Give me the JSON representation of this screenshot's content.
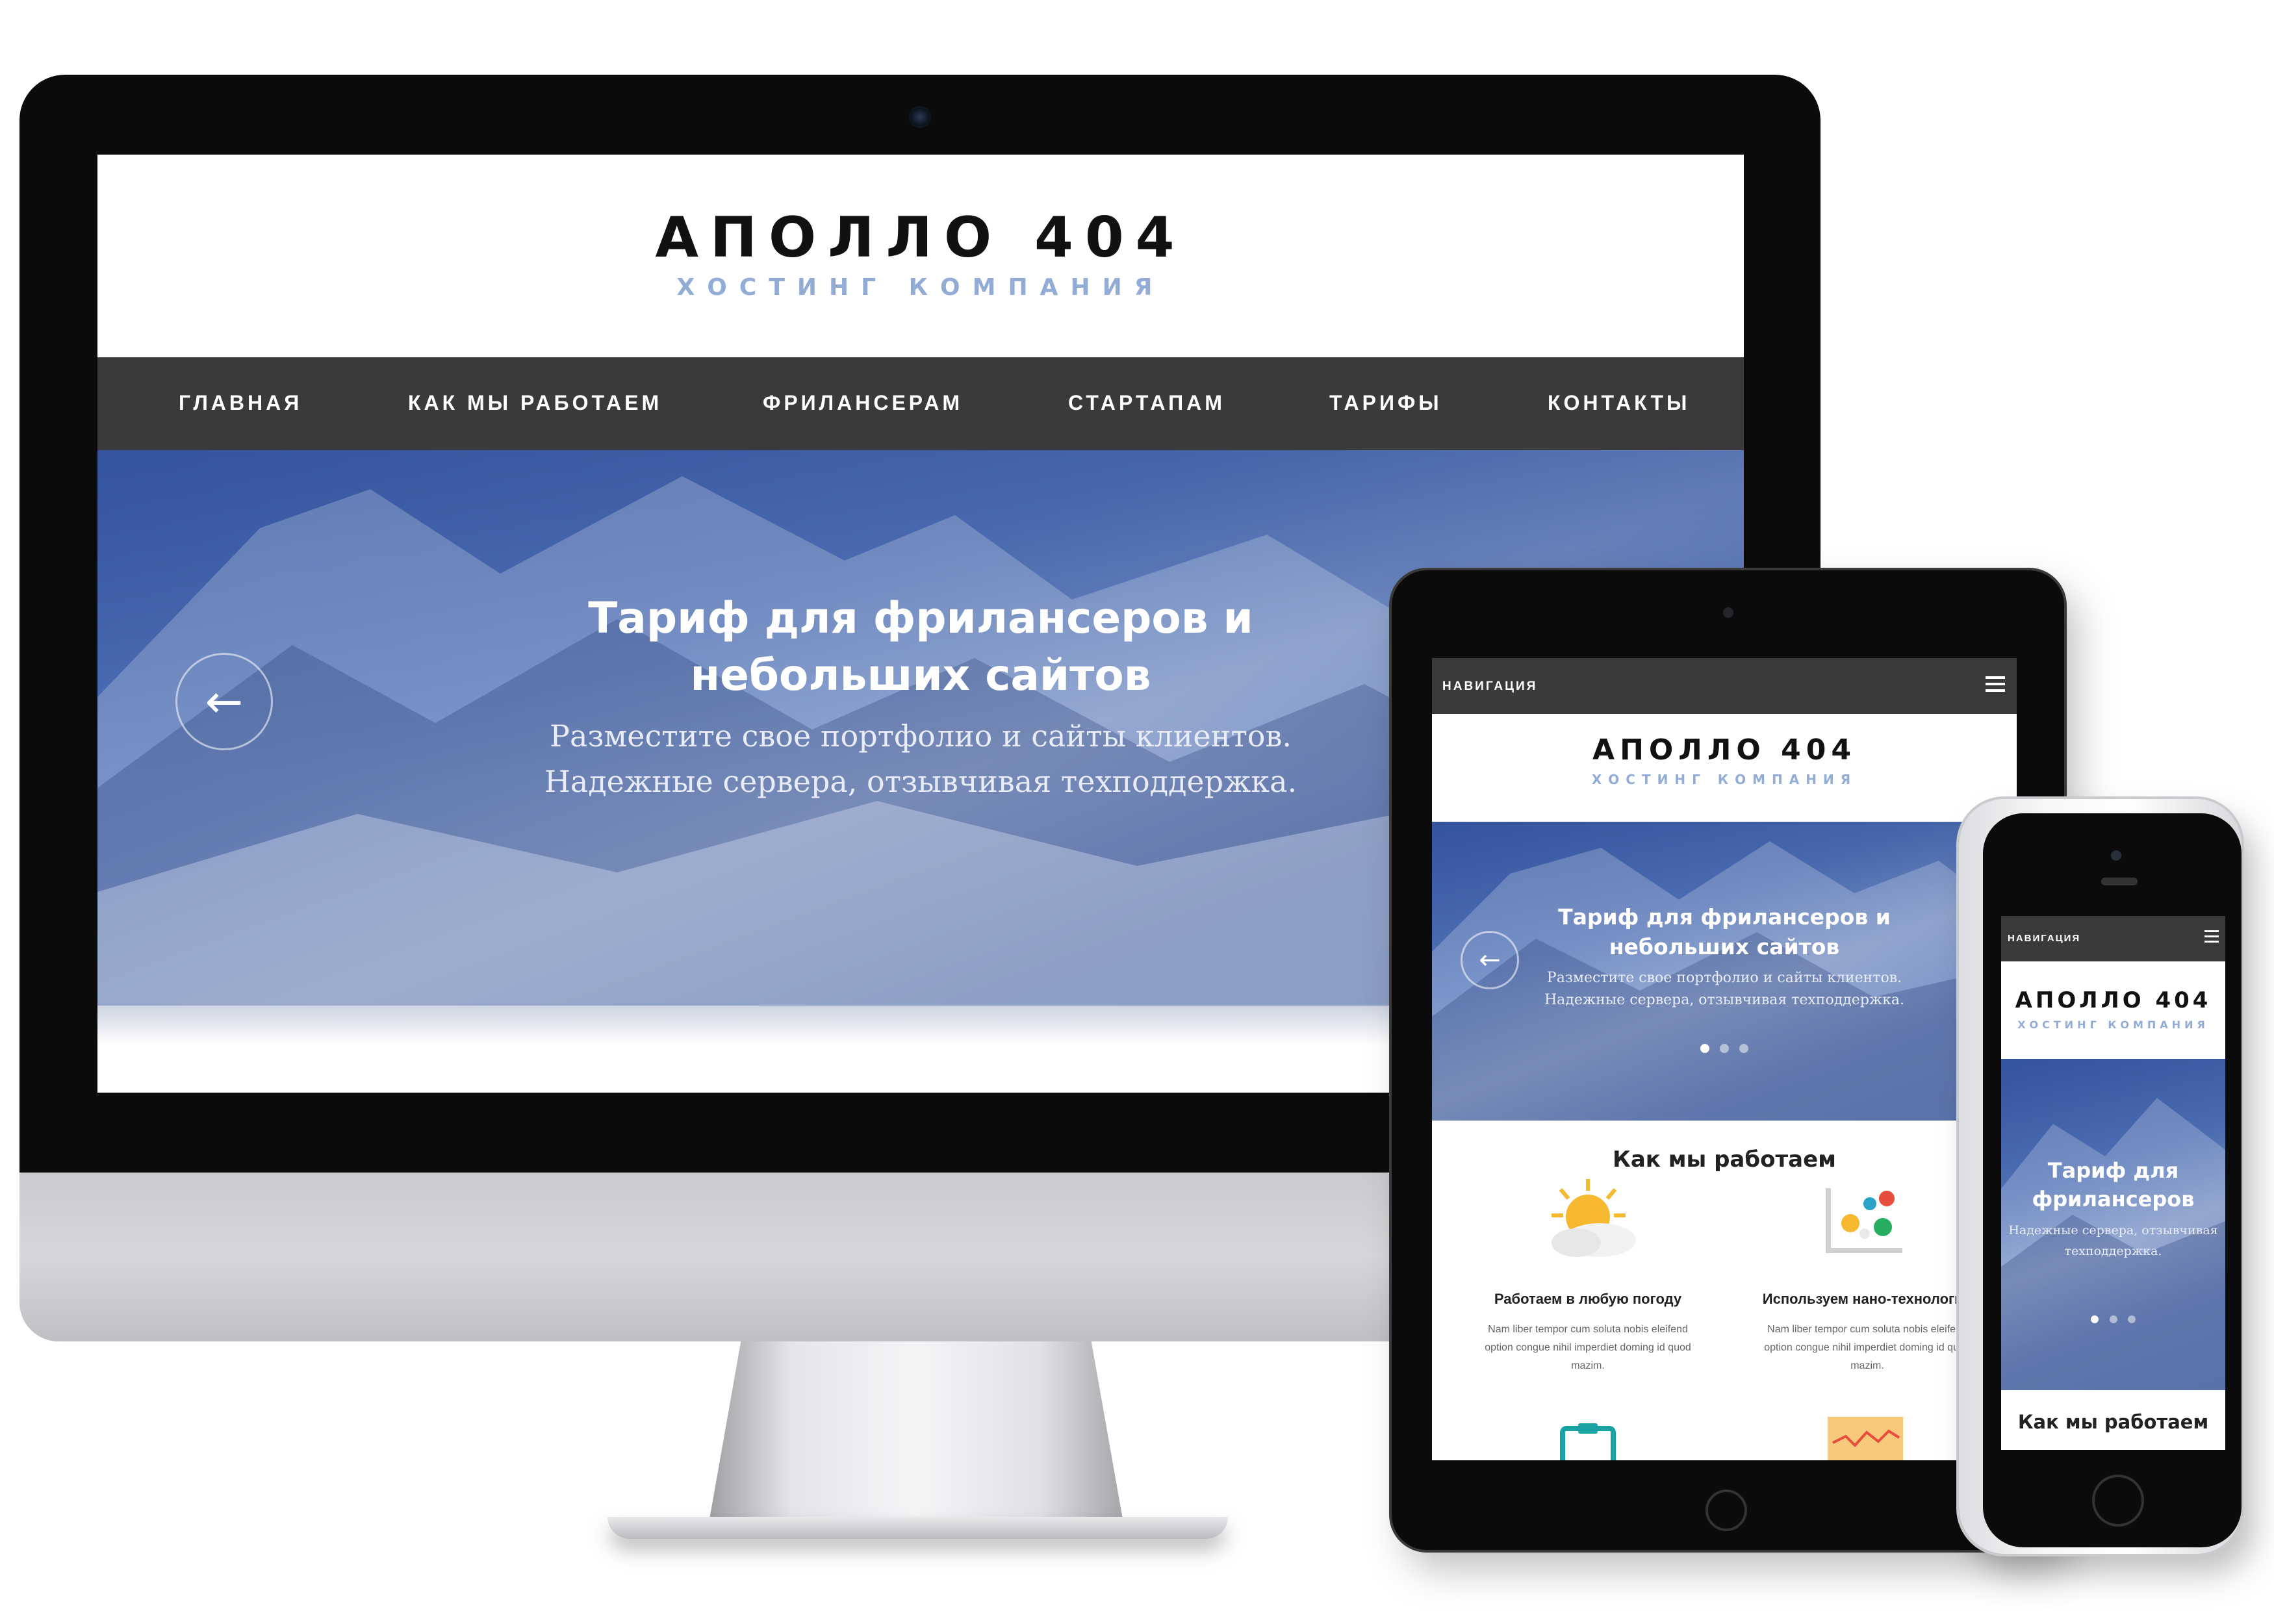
{
  "site": {
    "logo_title": "АПОЛЛО 404",
    "logo_subtitle": "ХОСТИНГ КОМПАНИЯ",
    "nav": [
      "ГЛАВНАЯ",
      "КАК МЫ РАБОТАЕМ",
      "ФРИЛАНСЕРАМ",
      "СТАРТАПАМ",
      "ТАРИФЫ",
      "КОНТАКТЫ"
    ],
    "mobile_nav_label": "НАВИГАЦИЯ",
    "hero_title_line1": "Тариф для фрилансеров и",
    "hero_title_line2": "небольших сайтов",
    "hero_sub_line1": "Разместите свое портфолио и сайты клиентов.",
    "hero_sub_line2": "Надежные сервера, отзывчивая техподдержка.",
    "section_title": "Как мы работаем",
    "feature1_title": "Работаем в любую погоду",
    "feature2_title": "Используем нано-технологии",
    "feature_text_1": "Nam liber tempor cum soluta nobis eleifend",
    "feature_text_2": "option congue nihil imperdiet doming id quod",
    "feature_text_3": "mazim.",
    "phone_hero_title_line1": "Тариф для",
    "phone_hero_title_line2": "фрилансеров",
    "phone_hero_sub_line1": "Надежные сервера, отзывчивая",
    "phone_hero_sub_line2": "техподдержка."
  },
  "colors": {
    "device_black": "#0b0b0b",
    "navbar": "#3a3a3c",
    "logo_subtitle": "#93acd6",
    "hero_blue": "#4a6cb0",
    "sun": "#f5b82e",
    "teal": "#1aa3a3"
  },
  "icons": [
    "arrow-left-icon",
    "hamburger-icon",
    "sun-cloud-icon",
    "bubbles-chart-icon",
    "clipboard-icon",
    "line-chart-icon",
    "camera-icon",
    "home-button-icon"
  ]
}
